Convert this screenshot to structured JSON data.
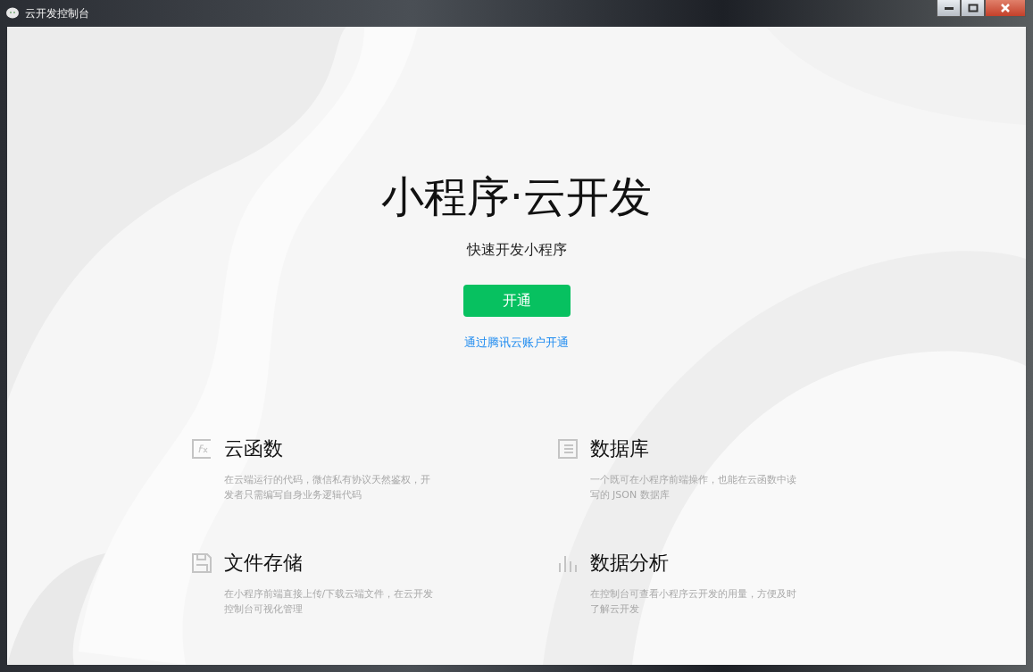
{
  "window": {
    "title": "云开发控制台"
  },
  "hero": {
    "title": "小程序·云开发",
    "subtitle": "快速开发小程序",
    "button": "开通",
    "link": "通过腾讯云账户开通"
  },
  "features": [
    {
      "kind": "function",
      "title": "云函数",
      "description": "在云端运行的代码，微信私有协议天然鉴权，开发者只需编写自身业务逻辑代码"
    },
    {
      "kind": "database",
      "title": "数据库",
      "description": "一个既可在小程序前端操作，也能在云函数中读写的 JSON 数据库"
    },
    {
      "kind": "storage",
      "title": "文件存储",
      "description": "在小程序前端直接上传/下载云端文件，在云开发控制台可视化管理"
    },
    {
      "kind": "analytics",
      "title": "数据分析",
      "description": "在控制台可查看小程序云开发的用量，方便及时了解云开发"
    }
  ]
}
